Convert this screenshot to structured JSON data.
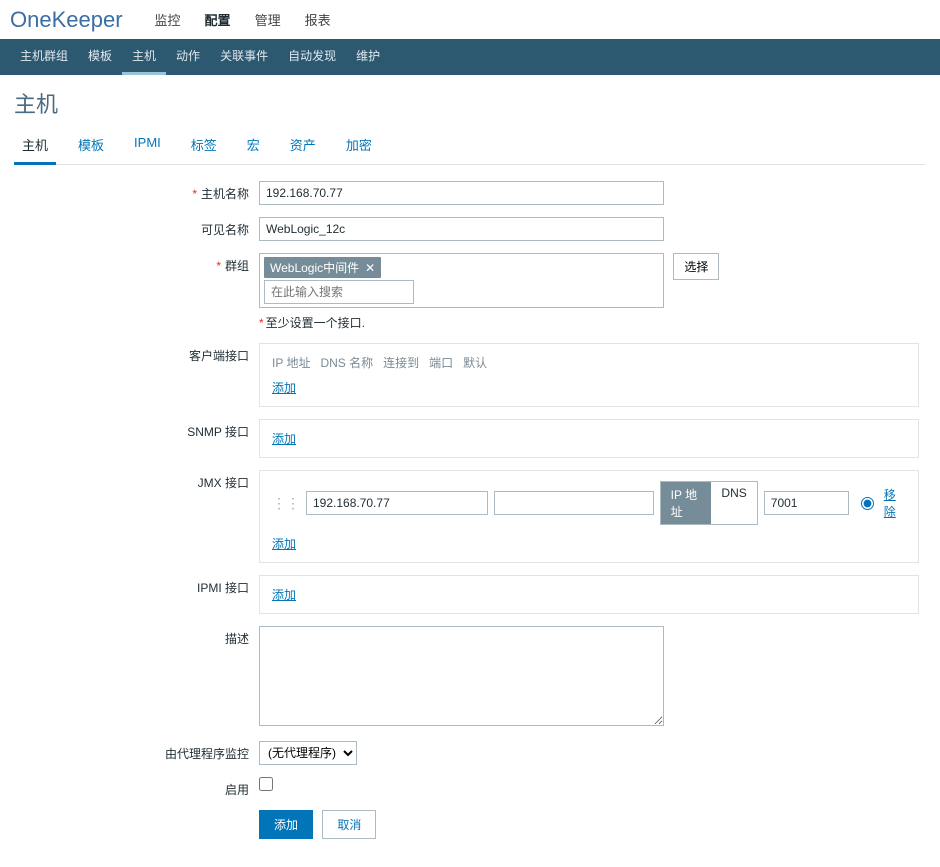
{
  "brand": "OneKeeper",
  "top_menu": {
    "monitor": "监控",
    "config": "配置",
    "manage": "管理",
    "report": "报表"
  },
  "sub_nav": {
    "hostgroup": "主机群组",
    "template": "模板",
    "host": "主机",
    "action": "动作",
    "event": "关联事件",
    "discovery": "自动发现",
    "maintain": "维护"
  },
  "page_title": "主机",
  "tabs": {
    "host": "主机",
    "template": "模板",
    "ipmi": "IPMI",
    "tag": "标签",
    "macro": "宏",
    "asset": "资产",
    "encrypt": "加密"
  },
  "labels": {
    "hostname": "主机名称",
    "visiblename": "可见名称",
    "group": "群组",
    "client_iface": "客户端接口",
    "snmp_iface": "SNMP 接口",
    "jmx_iface": "JMX 接口",
    "ipmi_iface": "IPMI 接口",
    "description": "描述",
    "proxy": "由代理程序监控",
    "enable": "启用"
  },
  "values": {
    "hostname": "192.168.70.77",
    "visiblename": "WebLogic_12c",
    "group_tag": "WebLogic中间件",
    "group_placeholder": "在此输入搜索",
    "jmx_ip": "192.168.70.77",
    "jmx_dns": "",
    "jmx_port": "7001",
    "proxy_option": "(无代理程序)"
  },
  "buttons": {
    "select": "选择",
    "add": "添加",
    "remove": "移除",
    "cancel": "取消",
    "submit": "添加"
  },
  "iface_headers": {
    "ip": "IP 地址",
    "dns": "DNS 名称",
    "connect": "连接到",
    "port": "端口",
    "default": "默认"
  },
  "toggle": {
    "ip": "IP 地址",
    "dns": "DNS"
  },
  "warning": "至少设置一个接口."
}
